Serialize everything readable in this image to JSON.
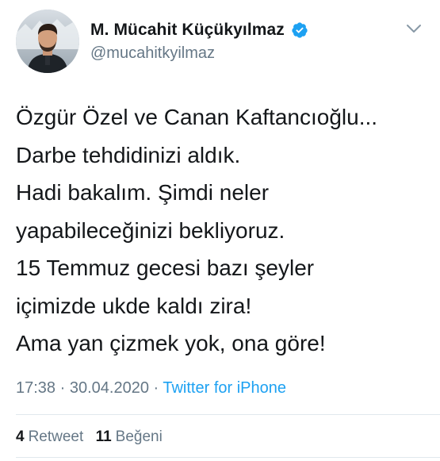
{
  "user": {
    "display_name": "M. Mücahit Küçükyılmaz",
    "handle": "@mucahitkyilmaz",
    "verified": true
  },
  "tweet": {
    "lines": [
      "Özgür Özel ve Canan Kaftancıoğlu...",
      "Darbe tehdidinizi aldık.",
      "Hadi bakalım. Şimdi neler",
      "yapabileceğinizi bekliyoruz.",
      "15 Temmuz gecesi bazı şeyler",
      "içimizde ukde kaldı zira!",
      "Ama yan çizmek yok, ona göre!"
    ]
  },
  "meta": {
    "time": "17:38",
    "separator": " · ",
    "date": "30.04.2020",
    "separator2": " · ",
    "source": "Twitter for iPhone"
  },
  "stats": {
    "retweets_count": "4",
    "retweets_label": "Retweet",
    "likes_count": "11",
    "likes_label": "Beğeni"
  },
  "icons": {
    "verified": "verified-badge-icon",
    "menu": "chevron-down-icon"
  },
  "colors": {
    "text": "#14171a",
    "secondary": "#657786",
    "link": "#1da1f2",
    "verified": "#1da1f2",
    "divider": "#e1e8ed"
  }
}
